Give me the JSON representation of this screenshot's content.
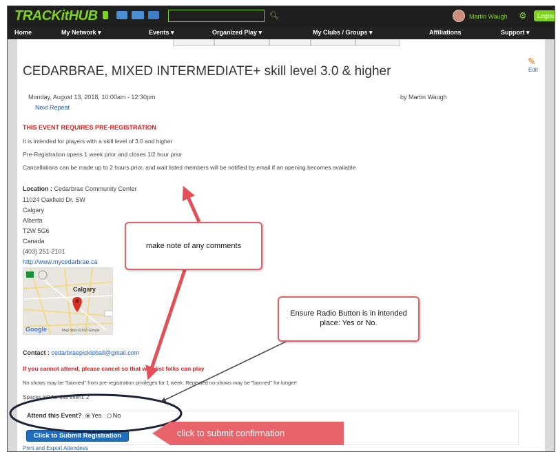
{
  "app": {
    "logo": "TRACKitHUB",
    "user_name": "Martin Waugh",
    "logout_label": "Logout"
  },
  "nav": [
    "Home",
    "My Network ▾",
    "Events ▾",
    "Organized Play ▾",
    "My Clubs / Groups ▾",
    "Affiliations",
    "Support ▾"
  ],
  "event": {
    "title": "CEDARBRAE, MIXED INTERMEDIATE+ skill level 3.0 & higher",
    "edit_label": "Edit",
    "datetime": "Monday, August 13, 2018, 10:00am - 12:30pm",
    "by": "by Martin Waugh",
    "next_repeat": "Next Repeat",
    "prereg_heading": "THIS EVENT REQUIRES PRE-REGISTRATION",
    "desc_lines": [
      "It is intended for players with a skill level of 3.0 and higher",
      "Pre-Registration opens 1 week prior and closes 1/2 hour prior",
      "Cancellations can be made up to 2 hours prior, and wait listed members will be notified by email if an opening becomes available"
    ],
    "location_label": "Location :",
    "location_name": "Cedarbrae Community Center",
    "address": [
      "11024 Oakfield Dr. SW",
      "Calgary",
      "Alberta",
      "T2W 5G6",
      "Canada",
      "(403) 251-2101"
    ],
    "website": "http://www.mycedarbrae.ca",
    "map": {
      "city": "Calgary",
      "credit": "Map data ©2018 Google",
      "brand": "Google"
    },
    "contact_label": "Contact :",
    "contact_email": "cedarbraepickleball@gmail.com",
    "cancel_notice": "If you cannot attend, please cancel so that wait-list folks can play",
    "noshow_notice": "No shows may be \"banned\" from pre-registration privileges for 1 week. Repeated no-shows may be \"banned\" for longer!",
    "spaces_left": "Spaces left for this event: 2",
    "attend_label": "Attend this Event?",
    "attend_options": [
      "Yes",
      "No"
    ],
    "attend_selected": "Yes",
    "submit_label": "Click to Submit Registration",
    "print_label": "Print and Export Attendees"
  },
  "annotations": {
    "comments": "make note of any comments",
    "radio": "Ensure Radio Button is in intended place: Yes or No.",
    "submit": "click to submit confirmation"
  },
  "colors": {
    "brand_green": "#7ed321",
    "alert_red": "#e21b1b",
    "callout_red": "#e06065",
    "submit_blue": "#1f6fc1"
  }
}
